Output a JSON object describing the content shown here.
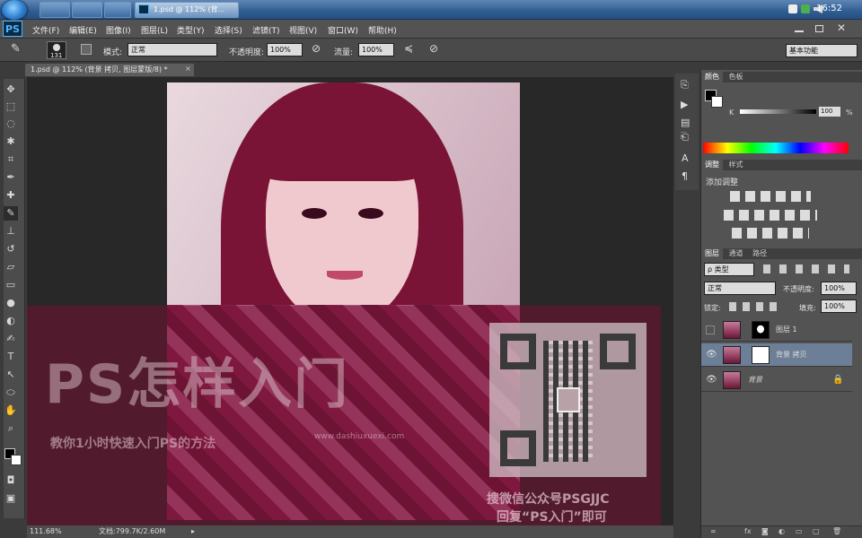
{
  "app": {
    "logo_text": "PS"
  },
  "taskbar": {
    "active_label": "1.psd @ 112% (背...",
    "clock": "16:52"
  },
  "menubar": {
    "items": [
      "文件(F)",
      "编辑(E)",
      "图像(I)",
      "图层(L)",
      "类型(Y)",
      "选择(S)",
      "滤镜(T)",
      "视图(V)",
      "窗口(W)",
      "帮助(H)"
    ]
  },
  "options": {
    "brush_size": "131",
    "mode_label": "模式:",
    "mode_value": "正常",
    "opacity_label": "不透明度:",
    "opacity_value": "100%",
    "flow_label": "流量:",
    "flow_value": "100%",
    "workspace": "基本功能"
  },
  "document": {
    "tab_title": "1.psd @ 112% (背景 拷贝, 图层蒙版/8) *",
    "zoom": "111.68%",
    "doc_size": "文档:799.7K/2.60M"
  },
  "watermark": {
    "big_text": "PS怎样入门",
    "sub_text": "教你1小时快速入门PS的方法",
    "url": "www.dashiuxuexi.com",
    "line1": "搜微信公众号PSGJJC",
    "line2": "回复“PS入门”即可"
  },
  "color_panel": {
    "tabs": [
      "颜色",
      "色板"
    ],
    "k_label": "K",
    "k_value": "100",
    "percent": "%"
  },
  "adjust_panel": {
    "tabs": [
      "调整",
      "样式"
    ],
    "title": "添加调整"
  },
  "layers_panel": {
    "tabs": [
      "图层",
      "通道",
      "路径"
    ],
    "filter_kind": "ρ 类型",
    "blend_mode": "正常",
    "opacity_label": "不透明度:",
    "opacity_value": "100%",
    "lock_label": "锁定:",
    "fill_label": "填充:",
    "fill_value": "100%",
    "layers": [
      {
        "name": "图层 1",
        "visible": false,
        "selected": false
      },
      {
        "name": "背景 拷贝",
        "visible": true,
        "selected": true
      },
      {
        "name": "背景",
        "visible": true,
        "selected": false
      }
    ]
  },
  "colors": {
    "accent": "#6d7f97",
    "panel": "#535353",
    "canvas": "#282828"
  }
}
